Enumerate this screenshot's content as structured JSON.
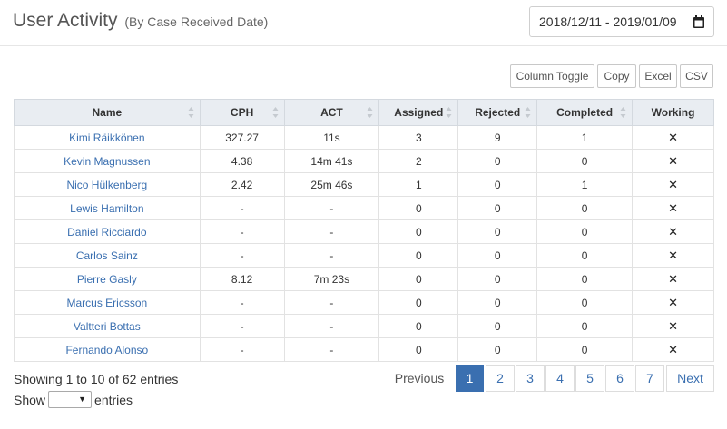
{
  "header": {
    "title": "User Activity",
    "subtitle": "(By Case Received Date)",
    "date_range": "2018/12/11 - 2019/01/09",
    "calendar_icon": "calendar-icon"
  },
  "toolbar": {
    "column_toggle": "Column Toggle",
    "copy": "Copy",
    "excel": "Excel",
    "csv": "CSV"
  },
  "table": {
    "columns": [
      "Name",
      "CPH",
      "ACT",
      "Assigned",
      "Rejected",
      "Completed",
      "Working"
    ],
    "rows": [
      {
        "name": "Kimi Räikkönen",
        "cph": "327.27",
        "act": "11s",
        "assigned": "3",
        "rejected": "9",
        "completed": "1",
        "working": "✕"
      },
      {
        "name": "Kevin Magnussen",
        "cph": "4.38",
        "act": "14m 41s",
        "assigned": "2",
        "rejected": "0",
        "completed": "0",
        "working": "✕"
      },
      {
        "name": "Nico Hülkenberg",
        "cph": "2.42",
        "act": "25m 46s",
        "assigned": "1",
        "rejected": "0",
        "completed": "1",
        "working": "✕"
      },
      {
        "name": "Lewis Hamilton",
        "cph": "-",
        "act": "-",
        "assigned": "0",
        "rejected": "0",
        "completed": "0",
        "working": "✕"
      },
      {
        "name": "Daniel Ricciardo",
        "cph": "-",
        "act": "-",
        "assigned": "0",
        "rejected": "0",
        "completed": "0",
        "working": "✕"
      },
      {
        "name": "Carlos Sainz",
        "cph": "-",
        "act": "-",
        "assigned": "0",
        "rejected": "0",
        "completed": "0",
        "working": "✕"
      },
      {
        "name": "Pierre Gasly",
        "cph": "8.12",
        "act": "7m 23s",
        "assigned": "0",
        "rejected": "0",
        "completed": "0",
        "working": "✕"
      },
      {
        "name": "Marcus Ericsson",
        "cph": "-",
        "act": "-",
        "assigned": "0",
        "rejected": "0",
        "completed": "0",
        "working": "✕"
      },
      {
        "name": "Valtteri Bottas",
        "cph": "-",
        "act": "-",
        "assigned": "0",
        "rejected": "0",
        "completed": "0",
        "working": "✕"
      },
      {
        "name": "Fernando Alonso",
        "cph": "-",
        "act": "-",
        "assigned": "0",
        "rejected": "0",
        "completed": "0",
        "working": "✕"
      }
    ]
  },
  "footer": {
    "info": "Showing 1 to 10 of 62 entries",
    "show_label": "Show",
    "entries_label": "entries",
    "page_size_value": ""
  },
  "pagination": {
    "previous": "Previous",
    "pages": [
      "1",
      "2",
      "3",
      "4",
      "5",
      "6",
      "7"
    ],
    "active_page": "1",
    "next": "Next"
  },
  "colors": {
    "link": "#3a6fb0",
    "header_bg": "#e9edf2"
  }
}
